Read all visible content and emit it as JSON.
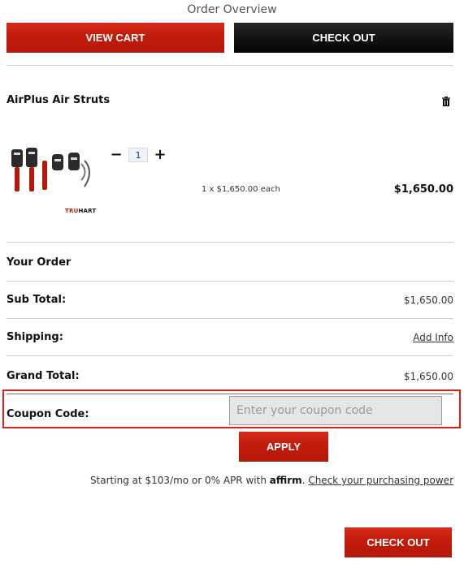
{
  "header": {
    "title": "Order Overview"
  },
  "actions": {
    "view_cart": "VIEW CART",
    "checkout_top": "CHECK OUT",
    "checkout_bottom": "CHECK OUT",
    "apply": "APPLY"
  },
  "cart": {
    "product_name": "AirPlus Air Struts",
    "quantity": "1",
    "each_text": "1 x $1,650.00 each",
    "line_total": "$1,650.00",
    "logo_text_red": "TRU",
    "logo_text_black": "HART"
  },
  "summary": {
    "your_order_label": "Your Order",
    "sub_total_label": "Sub Total:",
    "sub_total_value": "$1,650.00",
    "shipping_label": "Shipping:",
    "shipping_value": "Add Info",
    "grand_total_label": "Grand Total:",
    "grand_total_value": "$1,650.00",
    "coupon_label": "Coupon Code:",
    "coupon_placeholder": "Enter your coupon code"
  },
  "financing": {
    "prefix": "Starting at $103/mo or 0% APR with",
    "brand": "affirm",
    "suffix": ".",
    "link": "Check your purchasing power"
  },
  "colors": {
    "accent_red": "#c21c0c",
    "dark": "#111111",
    "divider": "#cfcfcf",
    "coupon_highlight": "#e31b1b"
  },
  "icons": {
    "trash": "trash-icon",
    "minus": "minus-icon",
    "plus": "plus-icon"
  }
}
